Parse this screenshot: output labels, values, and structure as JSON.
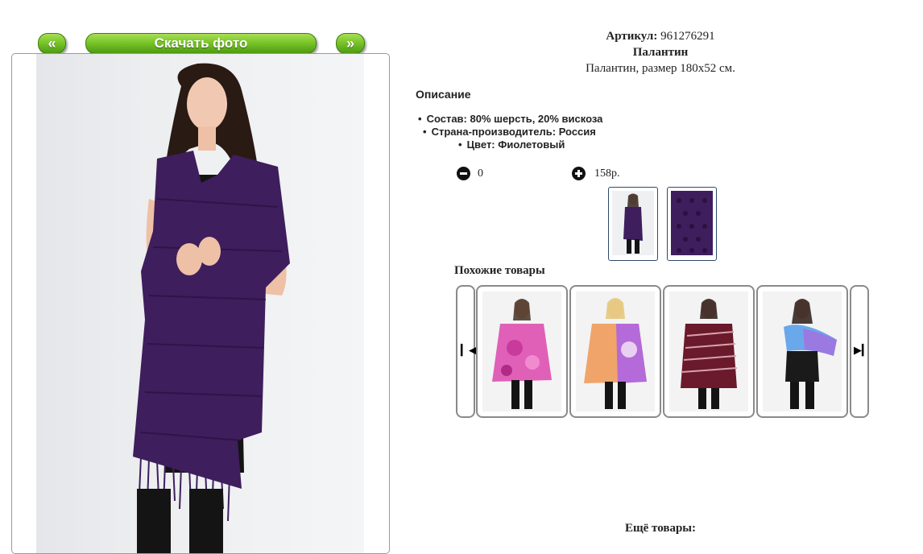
{
  "nav": {
    "prev_label": "«",
    "download_label": "Скачать фото",
    "next_label": "»"
  },
  "product": {
    "sku_label": "Артикул:",
    "sku_value": "961276291",
    "name": "Палантин",
    "description": "Палантин, размер 180х52 см."
  },
  "description_section": {
    "heading": "Описание",
    "specs": [
      "Состав: 80% шерсть, 20% вискоза",
      "Страна-производитель: Россия",
      "Цвет: Фиолетовый"
    ]
  },
  "cart": {
    "quantity": "0",
    "price": "158р."
  },
  "icons": {
    "minus": "minus-circle-icon",
    "plus": "plus-circle-icon",
    "slider_prev": "skip-back-icon",
    "slider_next": "skip-forward-icon"
  },
  "similar": {
    "heading": "Похожие товары"
  },
  "more": {
    "heading": "Ещё товары:"
  },
  "colors": {
    "button_green": "#79c52a",
    "scarf_purple": "#3e1e5c",
    "frame_gray": "#8a8a8a"
  }
}
